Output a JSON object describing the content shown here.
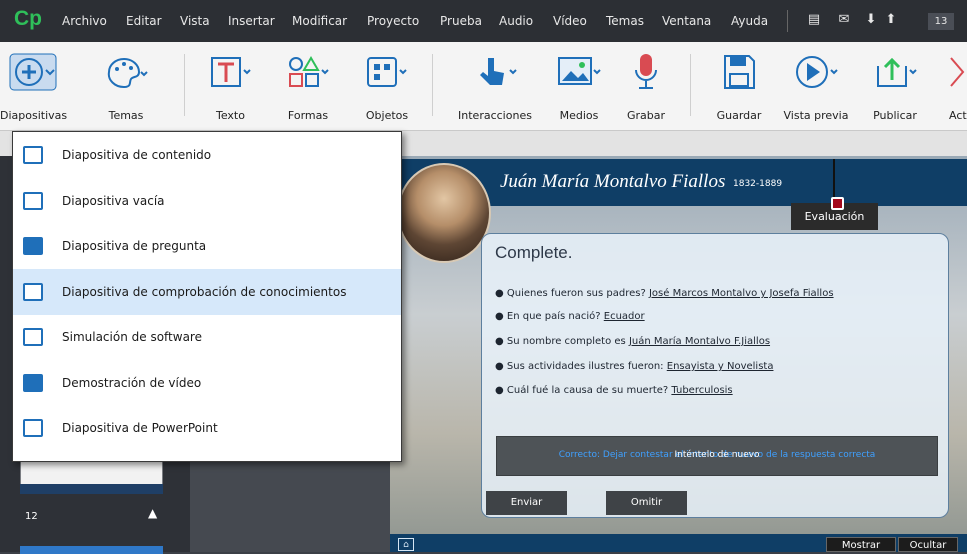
{
  "app": {
    "logo": "Cp",
    "page_number": "13"
  },
  "menu": [
    "Archivo",
    "Editar",
    "Vista",
    "Insertar",
    "Modificar",
    "Proyecto",
    "Prueba",
    "Audio",
    "Vídeo",
    "Temas",
    "Ventana",
    "Ayuda"
  ],
  "toolbar": {
    "diapositivas": "Diapositivas",
    "temas": "Temas",
    "texto": "Texto",
    "formas": "Formas",
    "objetos": "Objetos",
    "interacciones": "Interacciones",
    "medios": "Medios",
    "grabar": "Grabar",
    "guardar": "Guardar",
    "vista_previa": "Vista previa",
    "publicar": "Publicar",
    "act": "Act"
  },
  "colors": {
    "accent": "#1f6fb9",
    "title_bar": "#0f3e66",
    "rec": "#d94b52"
  },
  "dropdown": {
    "items": [
      {
        "label": "Diapositiva de contenido",
        "icon": "content-slide-icon"
      },
      {
        "label": "Diapositiva vacía",
        "icon": "blank-slide-icon"
      },
      {
        "label": "Diapositiva de pregunta",
        "icon": "question-slide-icon"
      },
      {
        "label": "Diapositiva de comprobación de conocimientos",
        "icon": "knowledge-check-icon",
        "selected": true
      },
      {
        "label": "Simulación de software",
        "icon": "software-sim-icon"
      },
      {
        "label": "Demostración de vídeo",
        "icon": "video-demo-icon"
      },
      {
        "label": "Diapositiva de PowerPoint",
        "icon": "powerpoint-icon"
      }
    ]
  },
  "filmstrip": {
    "slide_number": "12"
  },
  "slide": {
    "title": "Juán María Montalvo Fiallos",
    "years": "1832-1889",
    "eval_button": "Evaluación",
    "question_title": "Complete.",
    "bullets": [
      {
        "text": "Quienes fueron sus padres?",
        "answer": "José Marcos Montalvo y Josefa Fiallos"
      },
      {
        "text": "En que país nació?",
        "answer": "Ecuador"
      },
      {
        "text": "Su nombre completo es",
        "answer": "Juán María Montalvo F.Jiallos"
      },
      {
        "text": "Sus actividades ilustres fueron:",
        "answer": "Ensayista y Novelista"
      },
      {
        "text": "Cuál fué la causa de su muerte?",
        "answer": "Tuberculosis"
      }
    ],
    "feedback_text": "Correcto: Dejar contestar el intento de nuevo de la respuesta correcta",
    "feedback_overlay": "Inténtelo de nuevo",
    "enviar": "Enviar",
    "omitir": "Omitir",
    "mostrar": "Mostrar",
    "ocultar": "Ocultar"
  }
}
